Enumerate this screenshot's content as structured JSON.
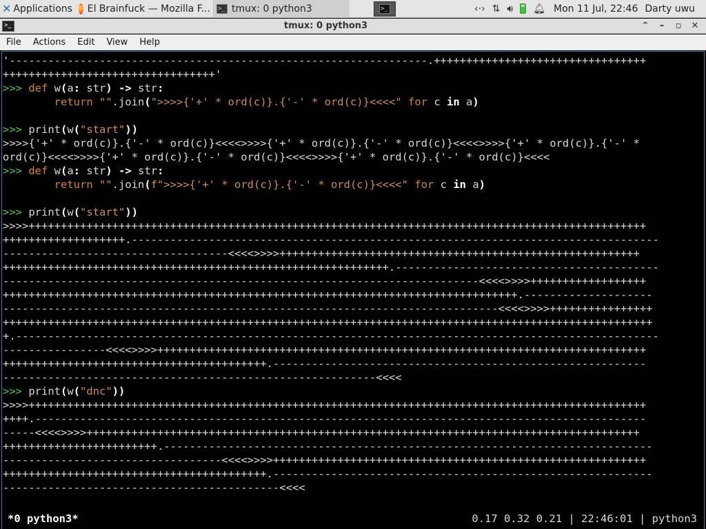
{
  "panel": {
    "applications_label": "Applications",
    "tasks": [
      {
        "label": "El Brainfuck — Mozilla F..."
      },
      {
        "label": "tmux: 0 python3"
      }
    ],
    "clock": "Mon 11 Jul, 22:46",
    "user": "Darty uwu"
  },
  "window": {
    "title": "tmux: 0 python3"
  },
  "menu": {
    "items": [
      "File",
      "Actions",
      "Edit",
      "View",
      "Help"
    ]
  },
  "terminal": {
    "lines": [
      "'-----------------------------------------------------------------.+++++++++++++++++++++++++++++++++",
      "+++++++++++++++++++++++++++++++++'",
      ">>> def w(a: str) -> str:",
      "        return \"\".join(\">>>>{'+' * ord(c)}.{'-' * ord(c)}<<<<\" for c in a)",
      "",
      ">>> print(w(\"start\"))",
      ">>>>{'+' * ord(c)}.{'-' * ord(c)}<<<<>>>>{'+' * ord(c)}.{'-' * ord(c)}<<<<>>>>{'+' * ord(c)}.{'-' *",
      "ord(c)}<<<<>>>>{'+' * ord(c)}.{'-' * ord(c)}<<<<>>>>{'+' * ord(c)}.{'-' * ord(c)}<<<<",
      ">>> def w(a: str) -> str:",
      "        return \"\".join(f\">>>>{'+' * ord(c)}.{'-' * ord(c)}<<<<\" for c in a)",
      "",
      ">>> print(w(\"start\"))",
      ">>>>++++++++++++++++++++++++++++++++++++++++++++++++++++++++++++++++++++++++++++++++++++++++++++++++",
      "+++++++++++++++++++.----------------------------------------------------------------------------------",
      "-----------------------------------<<<<>>>>++++++++++++++++++++++++++++++++++++++++++++++++++++++++",
      "++++++++++++++++++++++++++++++++++++++++++++++++++++++++++++.-----------------------------------------",
      "--------------------------------------------------------------------------<<<<>>>>++++++++++++++++++",
      "++++++++++++++++++++++++++++++++++++++++++++++++++++++++++++++++++++++++++++++++.--------------------",
      "-----------------------------------------------------------------------------<<<<>>>>++++++++++++++++",
      "+++++++++++++++++++++++++++++++++++++++++++++++++++++++++++++++++++++++++++++++++++++++++++++++++++++",
      "+.----------------------------------------------------------------------------------------------------",
      "----------------<<<<>>>>++++++++++++++++++++++++++++++++++++++++++++++++++++++++++++++++++++++++++++",
      "+++++++++++++++++++++++++++++++++++++++++.----------------------------------------------------------",
      "----------------------------------------------------------<<<<",
      ">>> print(w(\"dnc\"))",
      ">>>>++++++++++++++++++++++++++++++++++++++++++++++++++++++++++++++++++++++++++++++++++++++++++++++++",
      "++++.-----------------------------------------------------------------------------------------------",
      "-----<<<<>>>>++++++++++++++++++++++++++++++++++++++++++++++++++++++++++++++++++++++++++++++++++++++",
      "++++++++++++++++++++++++.----------------------------------------------------------------------------",
      "----------------------------------<<<<>>>>++++++++++++++++++++++++++++++++++++++++++++++++++++++++++",
      "+++++++++++++++++++++++++++++++++++++++++.-----------------------------------------------------------",
      "-------------------------------------------<<<<",
      ">>> "
    ]
  },
  "status": {
    "left": "*0 python3*",
    "right": "0.17 0.32 0.21 | 22:46:01 | python3"
  },
  "colors": {
    "prompt": "#4ec94e",
    "keyword": "#d0892f",
    "string": "#cf8c53",
    "window_border": "#3d7fc6"
  }
}
